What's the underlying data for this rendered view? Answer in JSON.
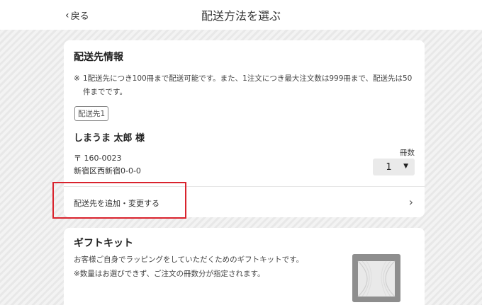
{
  "header": {
    "back_label": "戻る",
    "title": "配送方法を選ぶ"
  },
  "delivery": {
    "title": "配送先情報",
    "note_mark": "※",
    "note": "1配送先につき100冊まで配送可能です。また、1注文につき最大注文数は999冊まで、配送先は50件までです。",
    "tag": "配送先1",
    "recipient": "しまうま 太郎 様",
    "postal": "〒 160-0023",
    "address": "新宿区西新宿0-0-0",
    "qty_label": "冊数",
    "qty_value": "1",
    "add_link": "配送先を追加・変更する"
  },
  "gift": {
    "title": "ギフトキット",
    "line1": "お客様ご自身でラッピングをしていただくためのギフトキットです。",
    "line2": "※数量はお選びできず、ご注文の冊数分が指定されます。"
  },
  "colors": {
    "highlight": "#d9232d",
    "header_bg": "#ffffff",
    "select_bg": "#eaeaea"
  }
}
